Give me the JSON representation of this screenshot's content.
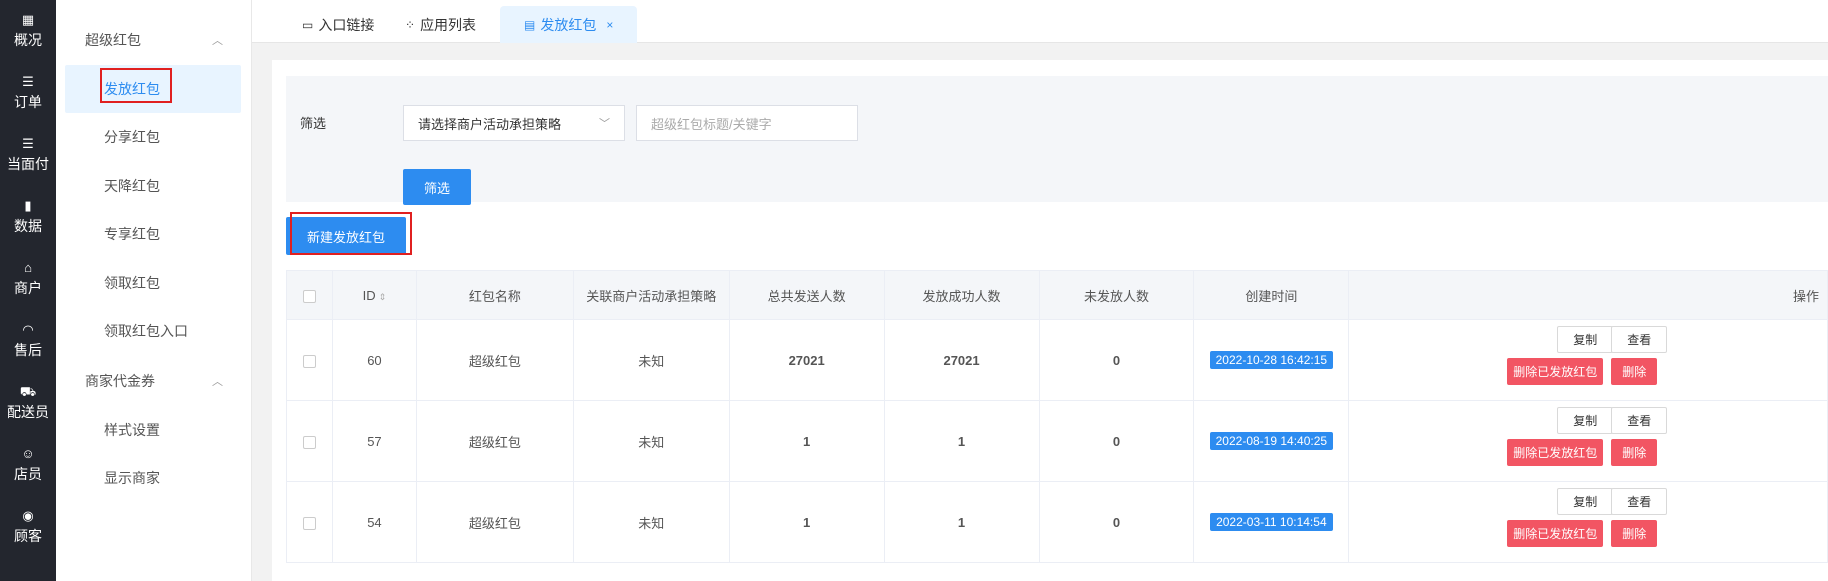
{
  "leftnav": [
    {
      "icon": "▦",
      "icon_name": "dashboard-icon",
      "label": "概况"
    },
    {
      "icon": "☰",
      "icon_name": "order-list-icon",
      "label": "订单"
    },
    {
      "icon": "☰",
      "icon_name": "payment-list-icon",
      "label": "当面付"
    },
    {
      "icon": "▮",
      "icon_name": "bar-chart-icon",
      "label": "数据"
    },
    {
      "icon": "⌂",
      "icon_name": "shop-icon",
      "label": "商户"
    },
    {
      "icon": "◠",
      "icon_name": "headset-icon",
      "label": "售后"
    },
    {
      "icon": "⛟",
      "icon_name": "delivery-icon",
      "label": "配送员"
    },
    {
      "icon": "☺",
      "icon_name": "clerk-icon",
      "label": "店员"
    },
    {
      "icon": "◉",
      "icon_name": "customer-icon",
      "label": "顾客"
    }
  ],
  "submenu": {
    "group1": {
      "label": "超级红包",
      "chevron": "︿"
    },
    "items": [
      {
        "label": "发放红包"
      },
      {
        "label": "分享红包"
      },
      {
        "label": "天降红包"
      },
      {
        "label": "专享红包"
      },
      {
        "label": "领取红包"
      },
      {
        "label": "领取红包入口"
      }
    ],
    "group2": {
      "label": "商家代金券",
      "chevron": "︿"
    },
    "items2": [
      {
        "label": "样式设置"
      },
      {
        "label": "显示商家"
      }
    ]
  },
  "tabs": [
    {
      "label": "入口链接",
      "icon": "▭"
    },
    {
      "label": "应用列表",
      "icon": "⁘"
    },
    {
      "label": "发放红包",
      "icon": "▤",
      "close": "×"
    }
  ],
  "filter": {
    "label": "筛选",
    "select_value": "请选择商户活动承担策略",
    "keyword_placeholder": "超级红包标题/关键字",
    "button": "筛选"
  },
  "new_button": "新建发放红包",
  "table": {
    "headers": [
      "ID",
      "红包名称",
      "关联商户活动承担策略",
      "总共发送人数",
      "发放成功人数",
      "未发放人数",
      "创建时间",
      "操作"
    ],
    "sort_icon": "⇕",
    "rows": [
      {
        "id": "60",
        "name": "超级红包",
        "strategy": "未知",
        "total": "27021",
        "success": "27021",
        "unsent": "0",
        "created": "2022-10-28 16:42:15"
      },
      {
        "id": "57",
        "name": "超级红包",
        "strategy": "未知",
        "total": "1",
        "success": "1",
        "unsent": "0",
        "created": "2022-08-19 14:40:25"
      },
      {
        "id": "54",
        "name": "超级红包",
        "strategy": "未知",
        "total": "1",
        "success": "1",
        "unsent": "0",
        "created": "2022-03-11 10:14:54"
      }
    ],
    "ops": {
      "copy": "复制",
      "view": "查看",
      "delete_sent": "删除已发放红包",
      "delete": "删除"
    }
  },
  "colors": {
    "accent": "#2d8cf0",
    "danger": "#f25563",
    "success": "#2bbd57",
    "nav_bg": "#23262e"
  }
}
